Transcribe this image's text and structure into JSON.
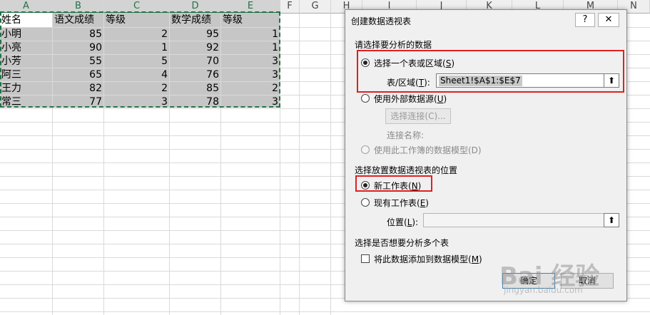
{
  "spreadsheet": {
    "columns": [
      "A",
      "B",
      "C",
      "D",
      "E",
      "F",
      "G",
      "H",
      "I",
      "J",
      "K",
      "L",
      "M",
      "N"
    ],
    "headers": [
      "姓名",
      "语文成绩",
      "等级",
      "数学成绩",
      "等级"
    ],
    "rows": [
      [
        "小明",
        "85",
        "2",
        "95",
        "1"
      ],
      [
        "小亮",
        "90",
        "1",
        "92",
        "1"
      ],
      [
        "小芳",
        "55",
        "5",
        "70",
        "3"
      ],
      [
        "阿三",
        "65",
        "4",
        "76",
        "3"
      ],
      [
        "王力",
        "82",
        "2",
        "85",
        "2"
      ],
      [
        "常三",
        "77",
        "3",
        "78",
        "3"
      ]
    ]
  },
  "dialog": {
    "title": "创建数据透视表",
    "help_label": "?",
    "close_label": "✕",
    "section1": "请选择要分析的数据",
    "opt_table": {
      "text": "选择一个表或区域(",
      "key": "S",
      "end": ")"
    },
    "range_label": {
      "text": "表/区域(",
      "key": "T",
      "end": "):"
    },
    "range_value": "Sheet1!$A$1:$E$7",
    "opt_external": {
      "text": "使用外部数据源(",
      "key": "U",
      "end": ")"
    },
    "choose_conn_label": "选择连接(C)...",
    "conn_name_label": "连接名称:",
    "opt_datamodel": "使用此工作簿的数据模型(D)",
    "section2": "选择放置数据透视表的位置",
    "opt_new": {
      "text": "新工作表(",
      "key": "N",
      "end": ")"
    },
    "opt_existing": {
      "text": "现有工作表(",
      "key": "E",
      "end": ")"
    },
    "location_label": {
      "text": "位置(",
      "key": "L",
      "end": "):"
    },
    "location_value": "",
    "section3": "选择是否想要分析多个表",
    "add_model": {
      "text": "将此数据添加到数据模型(",
      "key": "M",
      "end": ")"
    },
    "ok_label": "确定",
    "cancel_label": "取消",
    "pick_icon": "range-picker-icon"
  },
  "watermark": {
    "brand": "Bai 经验",
    "url": "jingyan.baidu.com"
  },
  "colors": {
    "accent": "#217346",
    "highlight": "#e02020",
    "selection": "#c6c6c6"
  }
}
